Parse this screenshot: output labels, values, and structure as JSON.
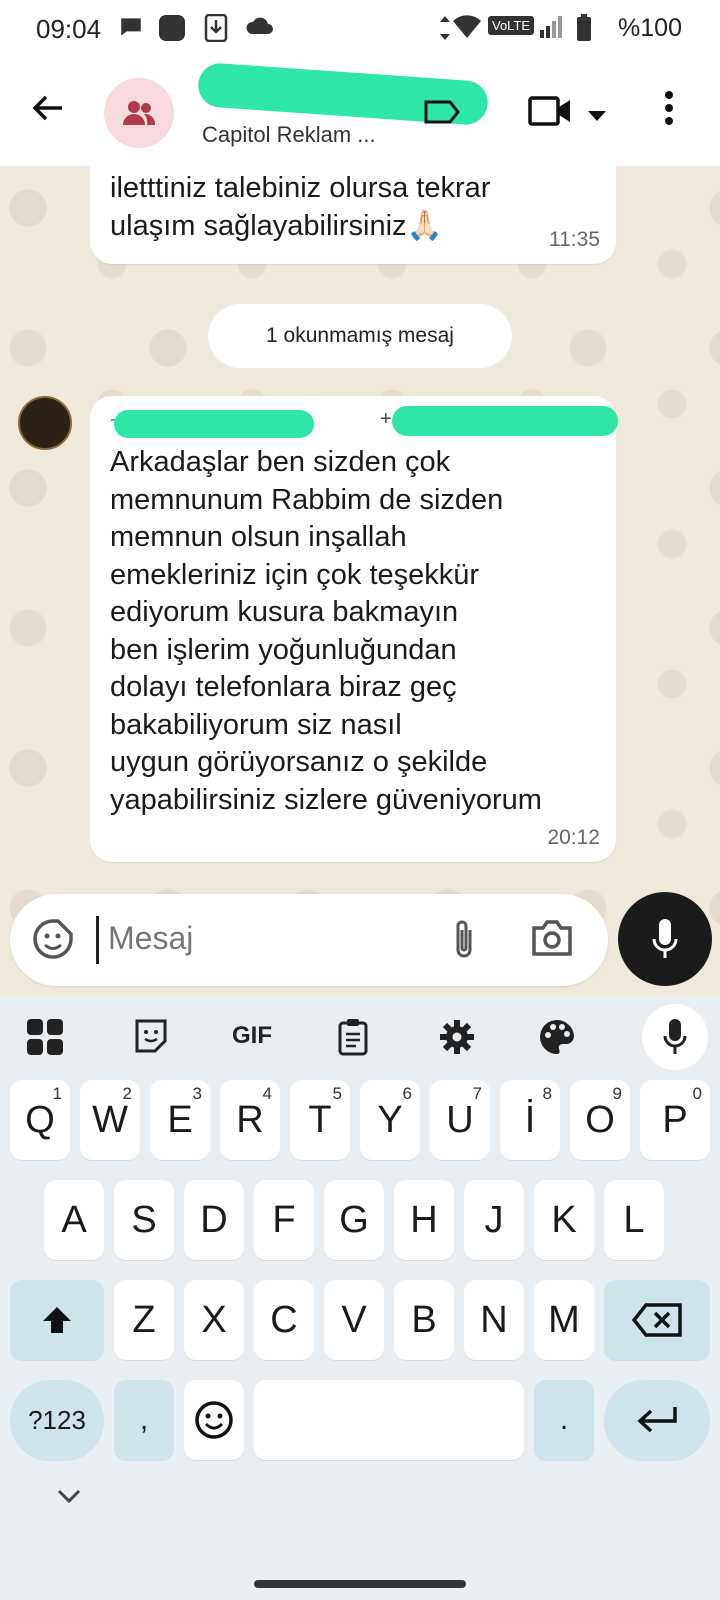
{
  "status_bar": {
    "time": "09:04",
    "battery": "%100",
    "network_badge": "VoLTE"
  },
  "header": {
    "subtitle": "Capitol Reklam ...",
    "title_redacted": true
  },
  "messages": [
    {
      "lines": [
        "iletttiniz talebiniz olursa tekrar",
        "ulaşım sağlayabilirsiniz🙏🏻"
      ],
      "time": "11:35"
    },
    {
      "lines": [
        "Arkadaşlar ben sizden çok",
        "memnunum Rabbim de sizden",
        "memnun olsun inşallah",
        "emekleriniz için çok teşekkür",
        "ediyorum kusura bakmayın",
        "ben işlerim yoğunluğundan",
        "dolayı telefonlara biraz geç",
        "bakabiliyorum siz nasıl",
        "uygun görüyorsanız o şekilde",
        "yapabilirsiniz sizlere güveniyorum"
      ],
      "time": "20:12",
      "sender_prefix": "~",
      "sender_phone_prefix": "+"
    }
  ],
  "unread_banner": "1 okunmamış mesaj",
  "input": {
    "placeholder": "Mesaj"
  },
  "keyboard": {
    "toolbar": {
      "gif_label": "GIF"
    },
    "row1": [
      {
        "k": "Q",
        "h": "1"
      },
      {
        "k": "W",
        "h": "2"
      },
      {
        "k": "E",
        "h": "3"
      },
      {
        "k": "R",
        "h": "4"
      },
      {
        "k": "T",
        "h": "5"
      },
      {
        "k": "Y",
        "h": "6"
      },
      {
        "k": "U",
        "h": "7"
      },
      {
        "k": "İ",
        "h": "8"
      },
      {
        "k": "O",
        "h": "9"
      },
      {
        "k": "P",
        "h": "0"
      }
    ],
    "row2": [
      "A",
      "S",
      "D",
      "F",
      "G",
      "H",
      "J",
      "K",
      "L"
    ],
    "row3": [
      "Z",
      "X",
      "C",
      "V",
      "B",
      "N",
      "M"
    ],
    "symbols_label": "?123",
    "comma": ",",
    "period": "."
  },
  "colors": {
    "chat_bg": "#efe9dc",
    "redaction": "#2ee6a6",
    "keyboard_bg": "#e9eef2",
    "fn_key": "#cfe3ea"
  }
}
